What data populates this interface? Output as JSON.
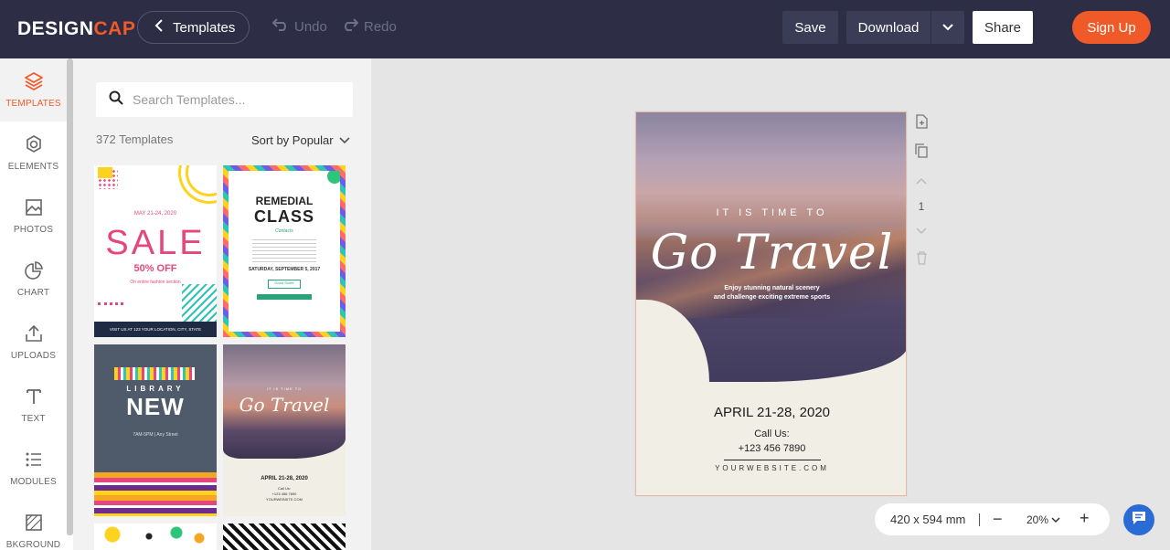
{
  "app": {
    "logo_main": "DESIGN",
    "logo_accent": "CAP"
  },
  "topbar": {
    "templates_label": "Templates",
    "undo_label": "Undo",
    "redo_label": "Redo",
    "save_label": "Save",
    "download_label": "Download",
    "share_label": "Share",
    "signup_label": "Sign Up"
  },
  "sidebar": {
    "items": [
      {
        "label": "TEMPLATES",
        "icon": "layers-icon",
        "active": true
      },
      {
        "label": "ELEMENTS",
        "icon": "elements-icon"
      },
      {
        "label": "PHOTOS",
        "icon": "image-icon"
      },
      {
        "label": "CHART",
        "icon": "pie-chart-icon"
      },
      {
        "label": "UPLOADS",
        "icon": "upload-icon"
      },
      {
        "label": "TEXT",
        "icon": "text-icon"
      },
      {
        "label": "MODULES",
        "icon": "list-icon"
      },
      {
        "label": "BKGROUND",
        "icon": "background-icon"
      }
    ]
  },
  "panel": {
    "search_placeholder": "Search Templates...",
    "count": "372 Templates",
    "sort_label": "Sort by Popular"
  },
  "thumbs": {
    "sale": {
      "date": "MAY 21-24, 2020",
      "title": "SALE",
      "discount": "50% OFF",
      "sub": "On entire fashion section",
      "footer": "VISIT US AT 123 YOUR LOCATION, CITY, STATE"
    },
    "remedial": {
      "line1": "REMEDIAL",
      "line2": "CLASS",
      "script": "Contacts",
      "date": "SATURDAY, SEPTEMBER 5, 2017",
      "button": "Good Score"
    },
    "library": {
      "line1": "LIBRARY",
      "line2": "NEW",
      "info": "7AM-5PM  |  Any Street"
    },
    "travel": {
      "kicker": "IT IS TIME TO",
      "title": "Go Travel",
      "date": "APRIL 21-28, 2020",
      "contact": "Call Us:",
      "phone": "+123 456 7890",
      "web": "YOURWEBSITE.COM"
    }
  },
  "canvas": {
    "kicker": "IT IS TIME TO",
    "title": "Go Travel",
    "tagline_1": "Enjoy stunning natural scenery",
    "tagline_2": "and challenge exciting extreme sports",
    "date": "APRIL 21-28, 2020",
    "call_label": "Call Us:",
    "phone": "+123 456 7890",
    "website": "YOURWEBSITE.COM",
    "page_number": "1"
  },
  "zoom": {
    "size": "420 x 594 mm",
    "minus": "−",
    "level": "20%",
    "plus": "+"
  },
  "colors": {
    "topbar_bg": "#2d2e45",
    "accent": "#f05a28",
    "chat": "#2b6bd6"
  }
}
